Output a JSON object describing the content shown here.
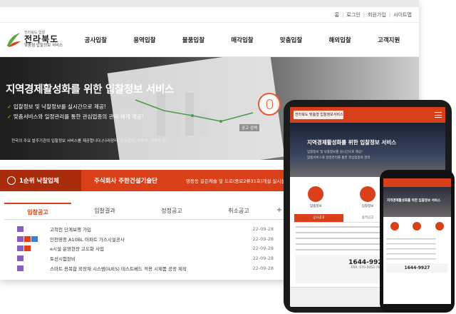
{
  "util_nav": [
    "홈",
    "로그인",
    "회원가입",
    "사이트맵"
  ],
  "logo": {
    "sub": "전라북도 입찰",
    "main": "전라북도",
    "tag": "맞춤형 입찰정보 서비스"
  },
  "gnb": [
    "공사입찰",
    "용역입찰",
    "물품입찰",
    "매각입찰",
    "맞춤입찰",
    "해외입찰",
    "고객지원"
  ],
  "hero": {
    "title": "지역경제활성화를 위한 입찰정보 서비스",
    "bullet1": "입찰정보 및 낙찰정보를 실시간으로 제공!",
    "bullet2": "맞춤서비스와 일정관리를 통한 관심업종의 관리 체계 제공!",
    "small": "전국의 주요 발주기관의 입찰정보 서비스를 제공합니다.(나라장터, 한국전력, 국방부, 아파트 등)",
    "pill": "공고 검색"
  },
  "rank": {
    "label": "1순위 낙찰업체",
    "winner": "주식회사 주한건설기술단",
    "next": "영등동 골든캐슬 앞 도로(중로2류31호)개설 실시설"
  },
  "tabs": [
    "입찰공고",
    "입찰결과",
    "정정공고",
    "취소공고"
  ],
  "tabs_plus": "+",
  "notices": [
    {
      "title": "고척천 단계보행 가입",
      "date": "22-09-28"
    },
    {
      "title": "인천영종 A10BL 아파트 가스시설공사",
      "date": "22-09-28"
    },
    {
      "title": "e시설 운영현장 고도화 사업",
      "date": "22-09-28"
    },
    {
      "title": "토션시험장비",
      "date": "22-09-28"
    },
    {
      "title": "스마트 용복합 외장재 시스템(IUES) 테스트베드 적용 시제품 공정 제작",
      "date": "22-09-28"
    }
  ],
  "tablet": {
    "logo": "전라북도 맞춤형 입찰정보서비스",
    "hero_title": "지역경제활성화를 위한 입찰정보 서비스",
    "hero_line1": "입찰정보 및 낙찰정보를 실시간으로 제공!",
    "hero_line2": "맞춤서비스와 일정관리를 통한 관심업종의 관리",
    "icons": [
      "맞춤정보",
      "입찰정보",
      "낙찰정보"
    ],
    "tabs": [
      "공사공고",
      "용역공고",
      "물품공고"
    ],
    "phone": "1644-9927",
    "fax": "FAX: 070-5052-7625"
  },
  "phone": {
    "hero_title": "지역경제활성화를 위한 입찰정보 서비스",
    "phone": "1644-9927"
  },
  "colors": {
    "accent": "#d9401a",
    "accent_dark": "#a92c0c",
    "check": "#f2a017"
  }
}
